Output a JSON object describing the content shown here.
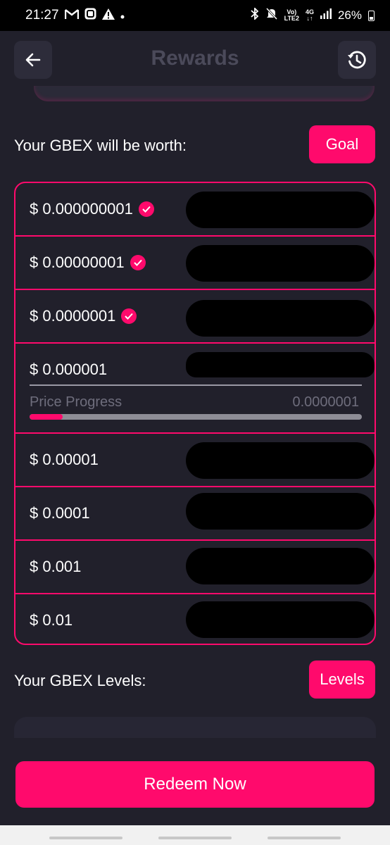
{
  "status_bar": {
    "time": "21:27",
    "lte_label_top": "Vo)",
    "lte_label_bottom": "LTE2",
    "net_top": "4G",
    "net_bottom": "↓↑",
    "battery": "26%"
  },
  "header": {
    "title": "Rewards"
  },
  "worth_section": {
    "label": "Your GBEX will be worth:",
    "goal_button": "Goal"
  },
  "price_levels": [
    {
      "price": "$ 0.000000001",
      "reached": true
    },
    {
      "price": "$ 0.00000001",
      "reached": true
    },
    {
      "price": "$ 0.0000001",
      "reached": true
    },
    {
      "price": "$ 0.000001",
      "reached": false,
      "progress_label": "Price Progress",
      "progress_value": "0.0000001",
      "progress_fraction": 0.1
    },
    {
      "price": "$ 0.00001",
      "reached": false
    },
    {
      "price": "$ 0.0001",
      "reached": false
    },
    {
      "price": "$ 0.001",
      "reached": false
    },
    {
      "price": "$ 0.01",
      "reached": false
    }
  ],
  "levels_section": {
    "label": "Your GBEX Levels:",
    "levels_button": "Levels"
  },
  "redeem_button": "Redeem Now",
  "colors": {
    "accent": "#ff0a6c",
    "background": "#21202b"
  }
}
